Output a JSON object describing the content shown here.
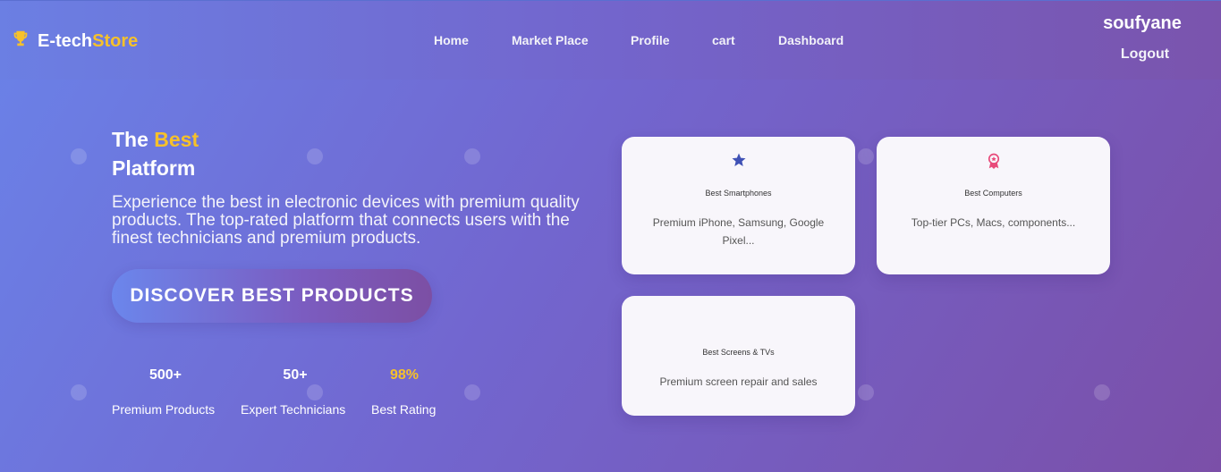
{
  "navbar": {
    "brand_prefix": "E-tech",
    "brand_accent": "Store",
    "brand_icon": "trophy-icon",
    "links": [
      "Home",
      "Market Place",
      "Profile",
      "cart",
      "Dashboard"
    ],
    "username": "soufyane",
    "logout_label": "Logout"
  },
  "hero": {
    "title_the": "The",
    "title_best": "Best",
    "title_platform": "Platform",
    "description": "Experience the best in electronic devices with premium quality products. The top-rated platform that connects users with the finest technicians and premium products.",
    "cta_label": "DISCOVER BEST PRODUCTS"
  },
  "stats": [
    {
      "value": "500+",
      "label": "Premium Products"
    },
    {
      "value": "50+",
      "label": "Expert Technicians"
    },
    {
      "value": "98%",
      "label": "Best Rating"
    }
  ],
  "cards": [
    {
      "icon": "star-icon",
      "title": "Best Smartphones",
      "text": "Premium iPhone, Samsung, Google Pixel..."
    },
    {
      "icon": "award-icon",
      "title": "Best Computers",
      "text": "Top-tier PCs, Macs, components..."
    },
    {
      "icon": "",
      "title": "Best Screens & TVs",
      "text": "Premium screen repair and sales"
    }
  ],
  "colors": {
    "accent_yellow": "#f6c12a",
    "star_blue": "#3f51b5",
    "award_pink": "#e84a7a",
    "card_bg": "#f8f6fb"
  }
}
